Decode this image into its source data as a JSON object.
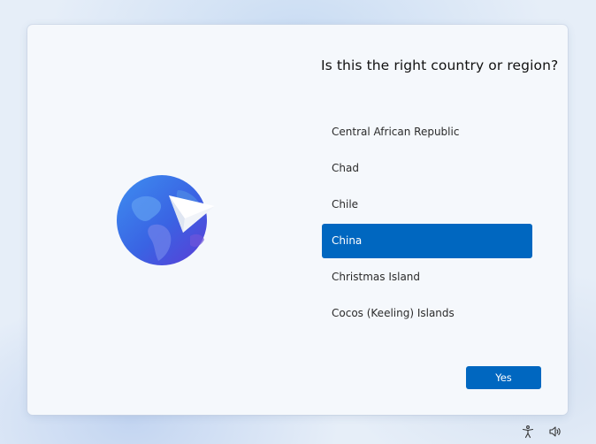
{
  "page": {
    "title": "Is this the right country or region?"
  },
  "countries": {
    "items": [
      {
        "label": "Central African Republic"
      },
      {
        "label": "Chad"
      },
      {
        "label": "Chile"
      },
      {
        "label": "China",
        "selected": true
      },
      {
        "label": "Christmas Island"
      },
      {
        "label": "Cocos (Keeling) Islands"
      }
    ]
  },
  "actions": {
    "yes_label": "Yes"
  },
  "illustration": {
    "icon": "globe-paper-plane-icon"
  },
  "taskbar": {
    "icons": [
      "accessibility-icon",
      "volume-icon"
    ]
  },
  "colors": {
    "accent": "#0067c0",
    "card": "#f5f8fc",
    "background": "#e6eef8"
  }
}
